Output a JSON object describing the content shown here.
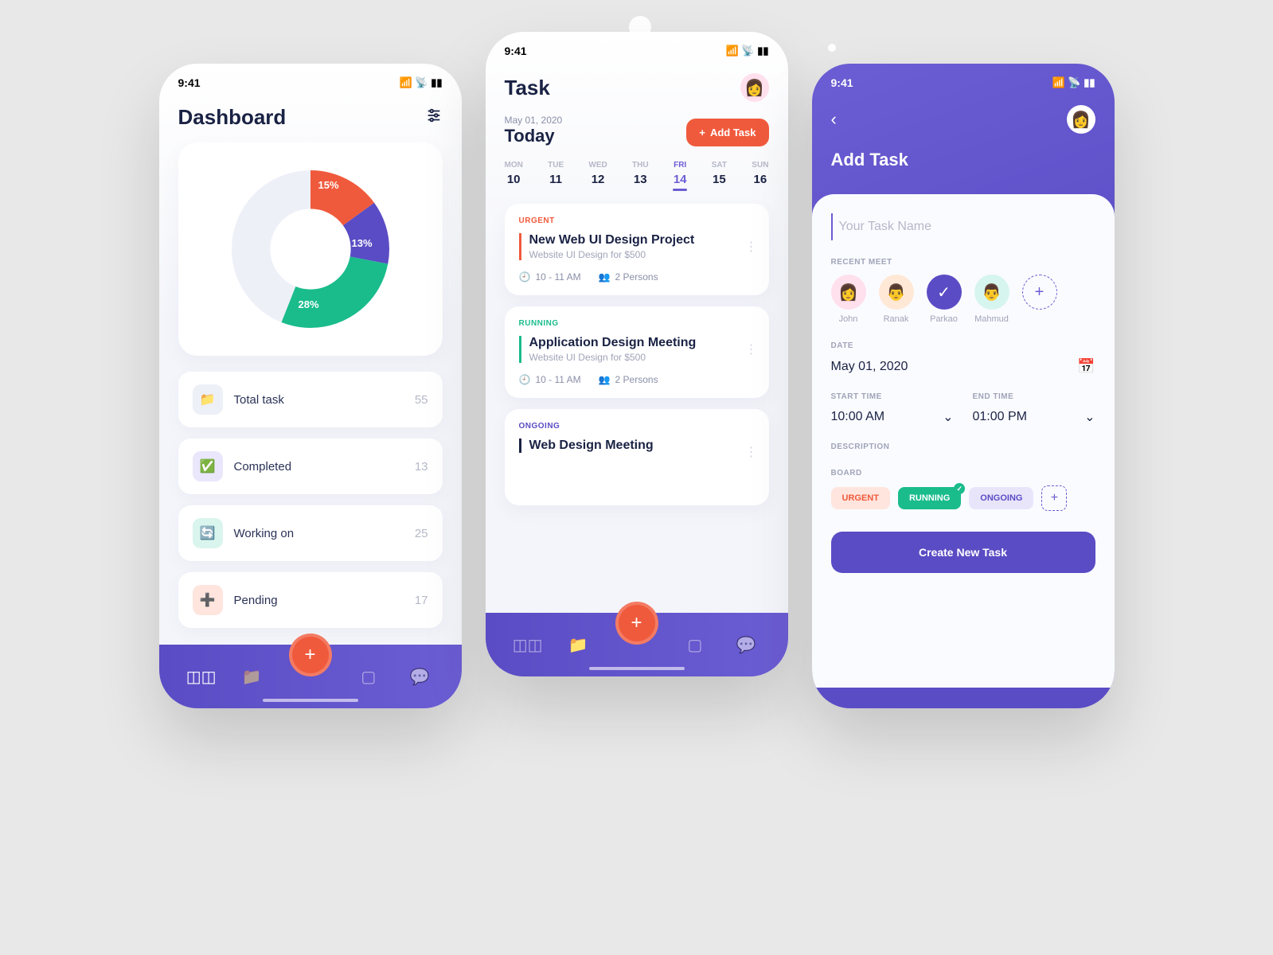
{
  "status": {
    "time": "9:41"
  },
  "dashboard": {
    "title": "Dashboard",
    "stats": {
      "total": {
        "label": "Total task",
        "value": "55"
      },
      "completed": {
        "label": "Completed",
        "value": "13"
      },
      "working": {
        "label": "Working on",
        "value": "25"
      },
      "pending": {
        "label": "Pending",
        "value": "17"
      }
    }
  },
  "chart_data": {
    "type": "pie",
    "title": "",
    "series": [
      {
        "name": "orange",
        "value": 15,
        "label": "15%",
        "color": "#f05a3c"
      },
      {
        "name": "purple",
        "value": 13,
        "label": "13%",
        "color": "#5a4cc4"
      },
      {
        "name": "teal",
        "value": 28,
        "label": "28%",
        "color": "#1abc8c"
      },
      {
        "name": "blank",
        "value": 44,
        "label": "",
        "color": "#eef0f8"
      }
    ]
  },
  "task": {
    "title": "Task",
    "date_small": "May 01, 2020",
    "today_label": "Today",
    "add_btn": "Add Task",
    "week": [
      {
        "d": "MON",
        "n": "10"
      },
      {
        "d": "TUE",
        "n": "11"
      },
      {
        "d": "WED",
        "n": "12"
      },
      {
        "d": "THU",
        "n": "13"
      },
      {
        "d": "FRI",
        "n": "14",
        "active": true
      },
      {
        "d": "SAT",
        "n": "15"
      },
      {
        "d": "SUN",
        "n": "16"
      }
    ],
    "cards": {
      "urgent": {
        "tag": "URGENT",
        "title": "New Web UI Design Project",
        "sub": "Website UI Design for $500",
        "time": "10 - 11 AM",
        "persons": "2 Persons",
        "color": "#f05a3c"
      },
      "running": {
        "tag": "RUNNING",
        "title": "Application Design Meeting",
        "sub": "Website UI Design for $500",
        "time": "10 - 11 AM",
        "persons": "2 Persons",
        "color": "#1abc8c"
      },
      "ongoing": {
        "tag": "ONGOING",
        "title": "Web Design Meeting",
        "color": "#1a2244"
      }
    }
  },
  "addtask": {
    "title": "Add Task",
    "name_placeholder": "Your Task Name",
    "labels": {
      "recent_meet": "RECENT MEET",
      "date": "DATE",
      "start": "START TIME",
      "end": "END TIME",
      "desc": "DESCRIPTION",
      "board": "BOARD"
    },
    "meet": [
      {
        "name": "John",
        "bg": "#ffe0ec"
      },
      {
        "name": "Ranak",
        "bg": "#ffe8d6"
      },
      {
        "name": "Parkao",
        "bg": "#5a4cc4",
        "checked": true
      },
      {
        "name": "Mahmud",
        "bg": "#d6f5ee"
      }
    ],
    "date_value": "May 01, 2020",
    "start_value": "10:00 AM",
    "end_value": "01:00 PM",
    "boards": {
      "urgent": {
        "label": "URGENT",
        "bg": "#ffe5dd",
        "fg": "#f05a3c"
      },
      "running": {
        "label": "RUNNING",
        "bg": "#1abc8c",
        "fg": "#fff",
        "checked": true
      },
      "ongoing": {
        "label": "ONGOING",
        "bg": "#e8e5fb",
        "fg": "#5a4cc4"
      }
    },
    "create_btn": "Create New Task"
  }
}
